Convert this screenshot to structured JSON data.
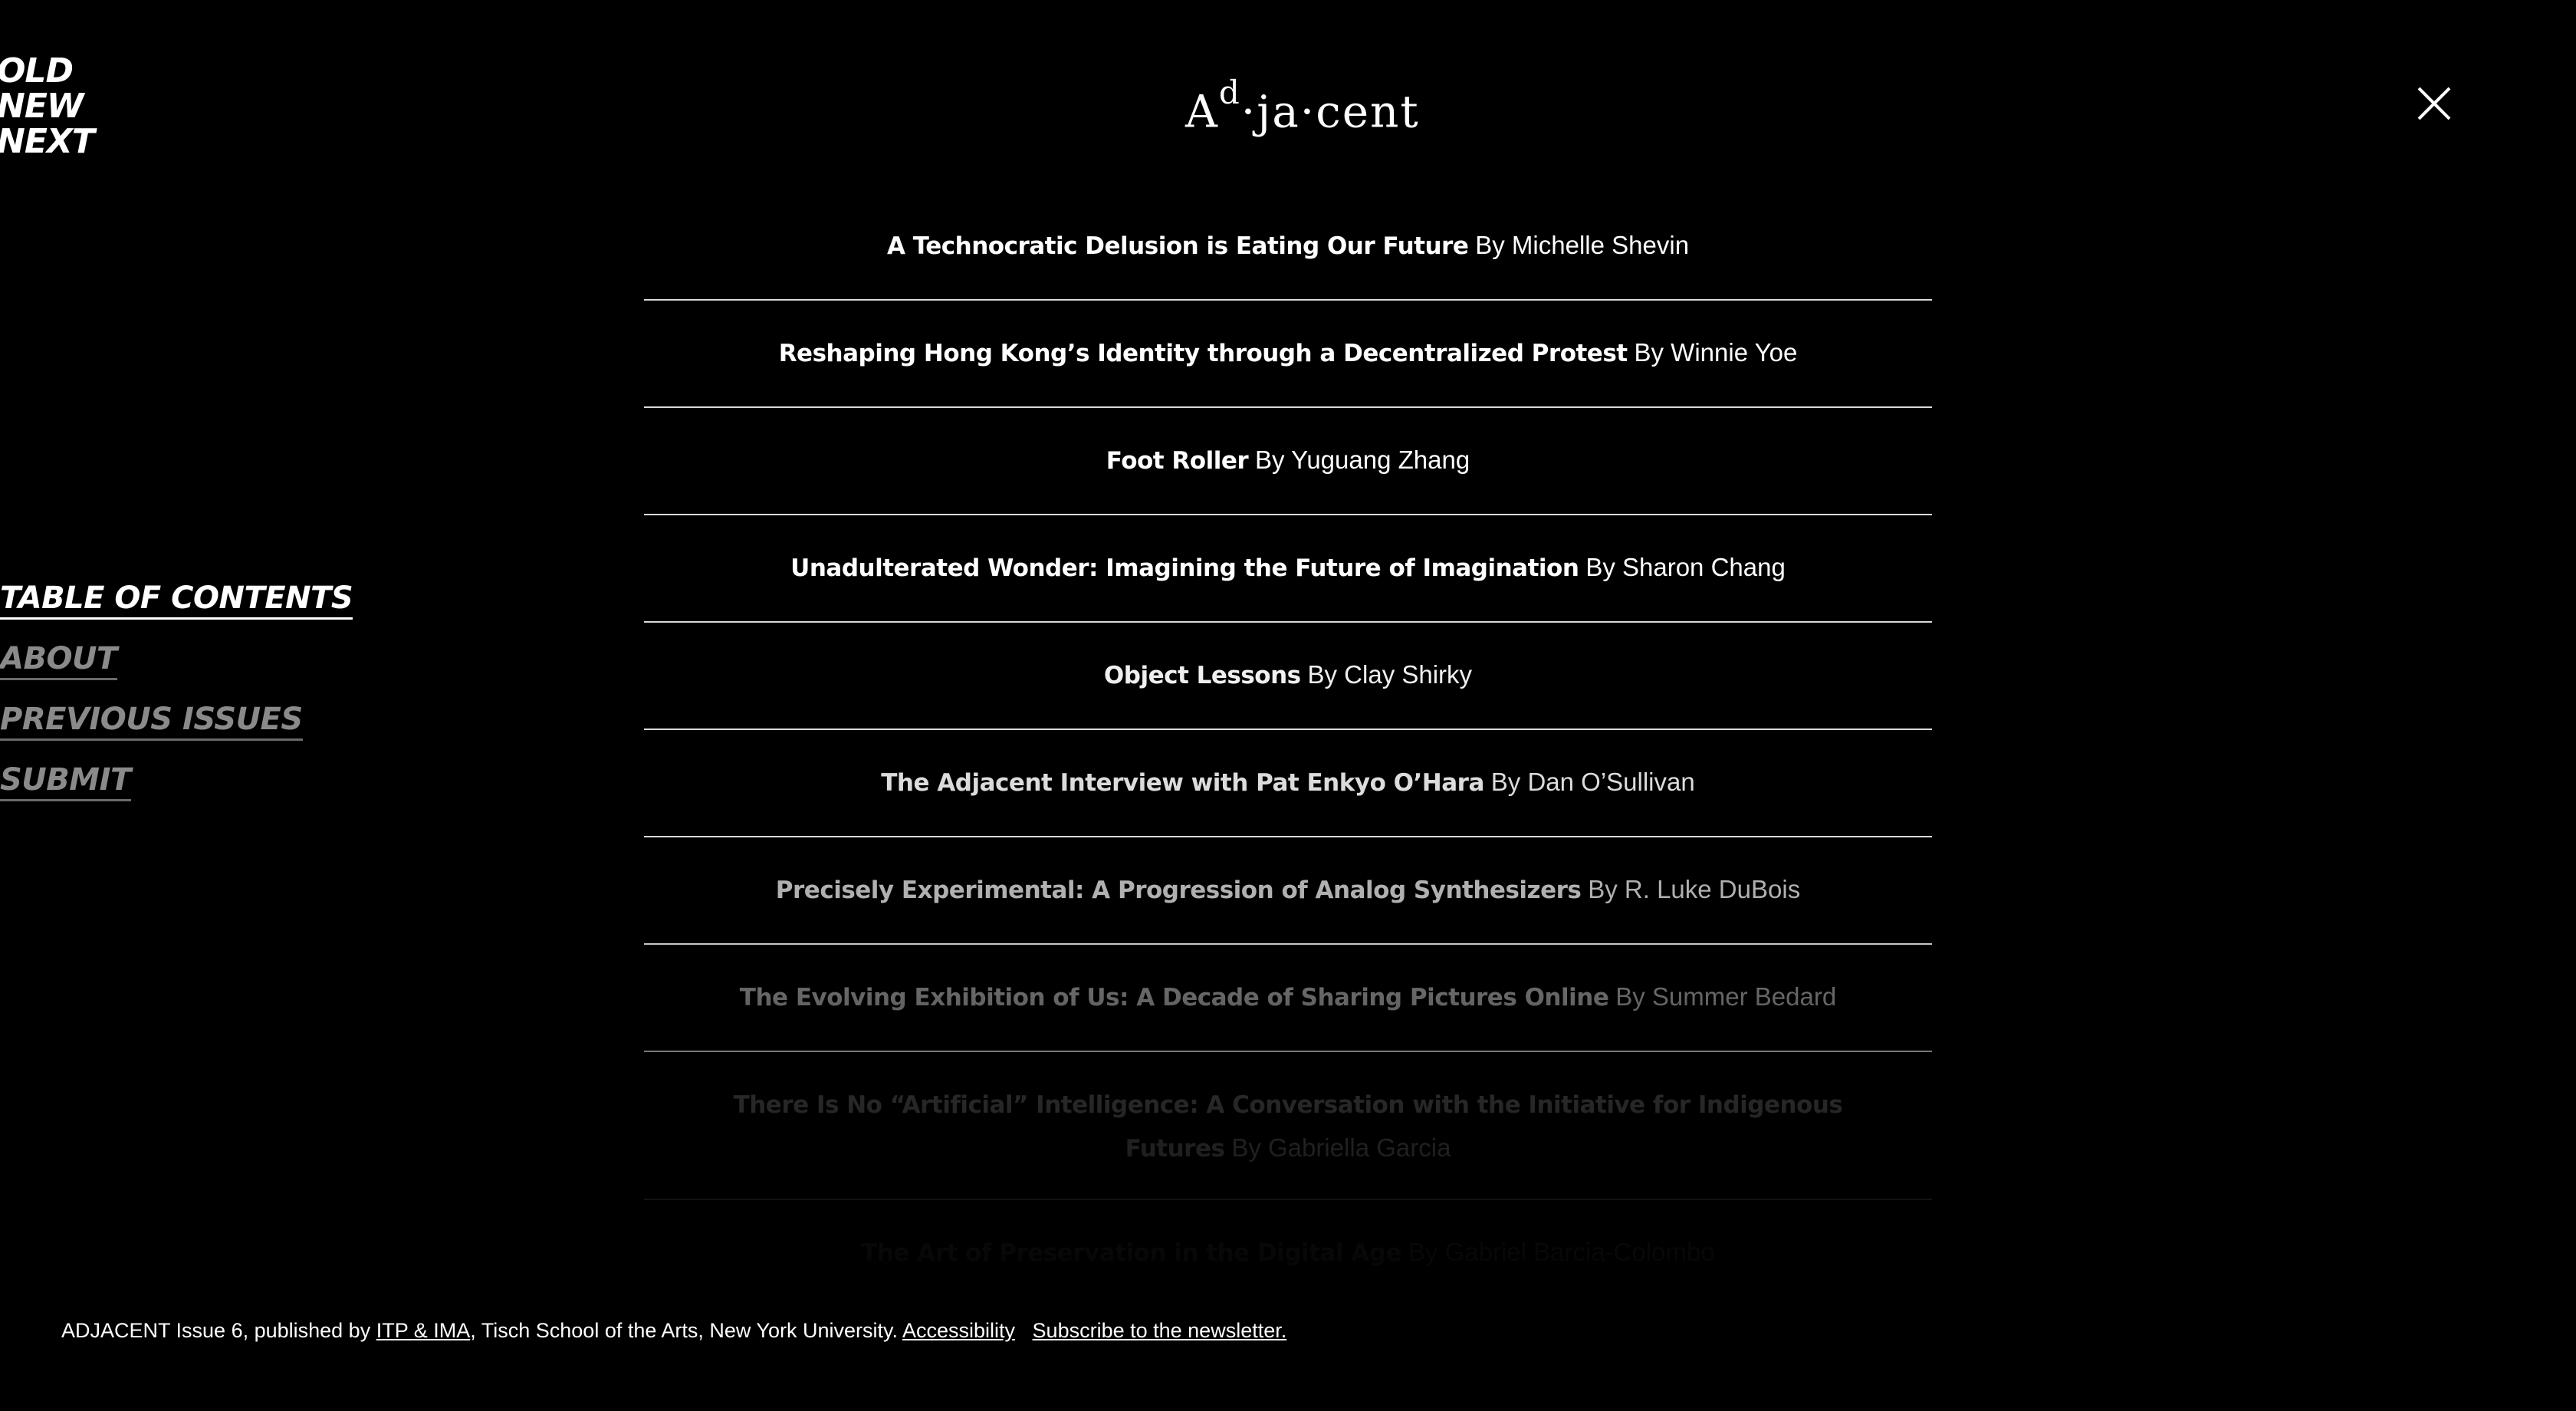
{
  "logo": {
    "lines": [
      "OLD",
      "NEW",
      "NEXT"
    ]
  },
  "header": {
    "wordmark_a": "A",
    "wordmark_sup": "d",
    "wordmark_rest": "·ja·cent"
  },
  "sidenav": {
    "items": [
      {
        "label": "TABLE OF CONTENTS"
      },
      {
        "label": "ABOUT"
      },
      {
        "label": "PREVIOUS ISSUES"
      },
      {
        "label": "SUBMIT"
      }
    ]
  },
  "toc": {
    "items": [
      {
        "title": "A Technocratic Delusion is Eating Our Future",
        "author": "By Michelle Shevin"
      },
      {
        "title": "Reshaping Hong Kong’s Identity through a Decentralized Protest",
        "author": "By Winnie Yoe"
      },
      {
        "title": "Foot Roller",
        "author": "By Yuguang Zhang"
      },
      {
        "title": "Unadulterated Wonder: Imagining the Future of Imagination",
        "author": "By Sharon Chang"
      },
      {
        "title": "Object Lessons",
        "author": "By Clay Shirky"
      },
      {
        "title": "The Adjacent Interview with Pat Enkyo O’Hara",
        "author": "By Dan O’Sullivan"
      },
      {
        "title": "Precisely Experimental: A Progression of Analog Synthesizers",
        "author": "By R. Luke DuBois"
      },
      {
        "title": "The Evolving Exhibition of Us: A Decade of Sharing Pictures Online",
        "author": "By Summer Bedard"
      },
      {
        "title": "There Is No “Artificial” Intelligence: A Conversation with the Initiative for Indigenous Futures",
        "author": "By Gabriella Garcia"
      },
      {
        "title": "The Art of Preservation in the Digital Age",
        "author": "By Gabriel Barcia-Colombo"
      }
    ]
  },
  "footer": {
    "prefix": "ADJACENT Issue 6, published by ",
    "itp_link": "ITP & IMA",
    "middle": ", Tisch School of the Arts, New York University. ",
    "accessibility_link": "Accessibility",
    "newsletter_link": "Subscribe to the newsletter."
  }
}
